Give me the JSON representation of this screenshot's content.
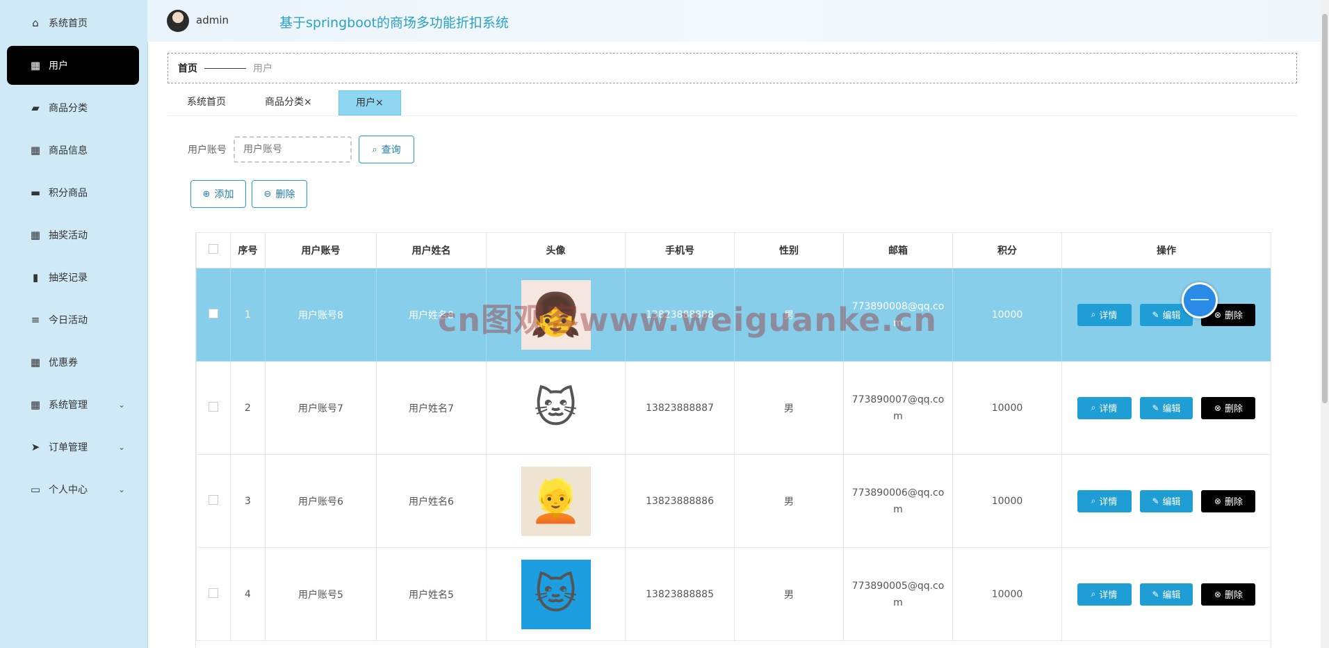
{
  "sidebar": {
    "items": [
      {
        "label": "系统首页",
        "icon": "home-icon"
      },
      {
        "label": "用户",
        "icon": "grid-icon",
        "active": true
      },
      {
        "label": "商品分类",
        "icon": "wallet-icon"
      },
      {
        "label": "商品信息",
        "icon": "grid-icon"
      },
      {
        "label": "积分商品",
        "icon": "chat-icon"
      },
      {
        "label": "抽奖活动",
        "icon": "grid-icon"
      },
      {
        "label": "抽奖记录",
        "icon": "bar-chart-icon"
      },
      {
        "label": "今日活动",
        "icon": "list-icon"
      },
      {
        "label": "优惠券",
        "icon": "grid-icon"
      },
      {
        "label": "系统管理",
        "icon": "grid-icon",
        "expandable": true
      },
      {
        "label": "订单管理",
        "icon": "send-icon",
        "expandable": true
      },
      {
        "label": "个人中心",
        "icon": "card-icon",
        "expandable": true
      }
    ]
  },
  "header": {
    "user": "admin",
    "title": "基于springboot的商场多功能折扣系统"
  },
  "breadcrumb": {
    "home": "首页",
    "current": "用户"
  },
  "tabs": [
    {
      "label": "系统首页",
      "closable": false
    },
    {
      "label": "商品分类",
      "closable": true
    },
    {
      "label": "用户",
      "closable": true,
      "active": true
    }
  ],
  "search": {
    "label": "用户账号",
    "placeholder": "用户账号",
    "button": "查询"
  },
  "actions": {
    "add": "添加",
    "delete": "删除"
  },
  "table": {
    "columns": [
      "序号",
      "用户账号",
      "用户姓名",
      "头像",
      "手机号",
      "性别",
      "邮箱",
      "积分",
      "操作"
    ],
    "rows": [
      {
        "index": "1",
        "account": "用户账号8",
        "name": "用户姓名8",
        "avatar": "red-hair-girl-avatar",
        "phone": "13823888888",
        "gender": "男",
        "email": "773890008@qq.com",
        "points": "10000",
        "selected": true
      },
      {
        "index": "2",
        "account": "用户账号7",
        "name": "用户姓名7",
        "avatar": "cat-avatar",
        "phone": "13823888887",
        "gender": "男",
        "email": "773890007@qq.com",
        "points": "10000"
      },
      {
        "index": "3",
        "account": "用户账号6",
        "name": "用户姓名6",
        "avatar": "anime-girl-avatar",
        "phone": "13823888886",
        "gender": "男",
        "email": "773890006@qq.com",
        "points": "10000"
      },
      {
        "index": "4",
        "account": "用户账号5",
        "name": "用户姓名5",
        "avatar": "doraemon-avatar",
        "phone": "13823888885",
        "gender": "男",
        "email": "773890005@qq.com",
        "points": "10000"
      }
    ],
    "row_buttons": {
      "detail": "详情",
      "edit": "编辑",
      "delete": "删除"
    }
  },
  "watermark": "cn图观客www.weiguanke.cn",
  "colors": {
    "sidebar_bg": "#cfe9f7",
    "accent": "#1f9ed6",
    "selected_row": "#87ceeb",
    "active_menu": "#000000"
  }
}
